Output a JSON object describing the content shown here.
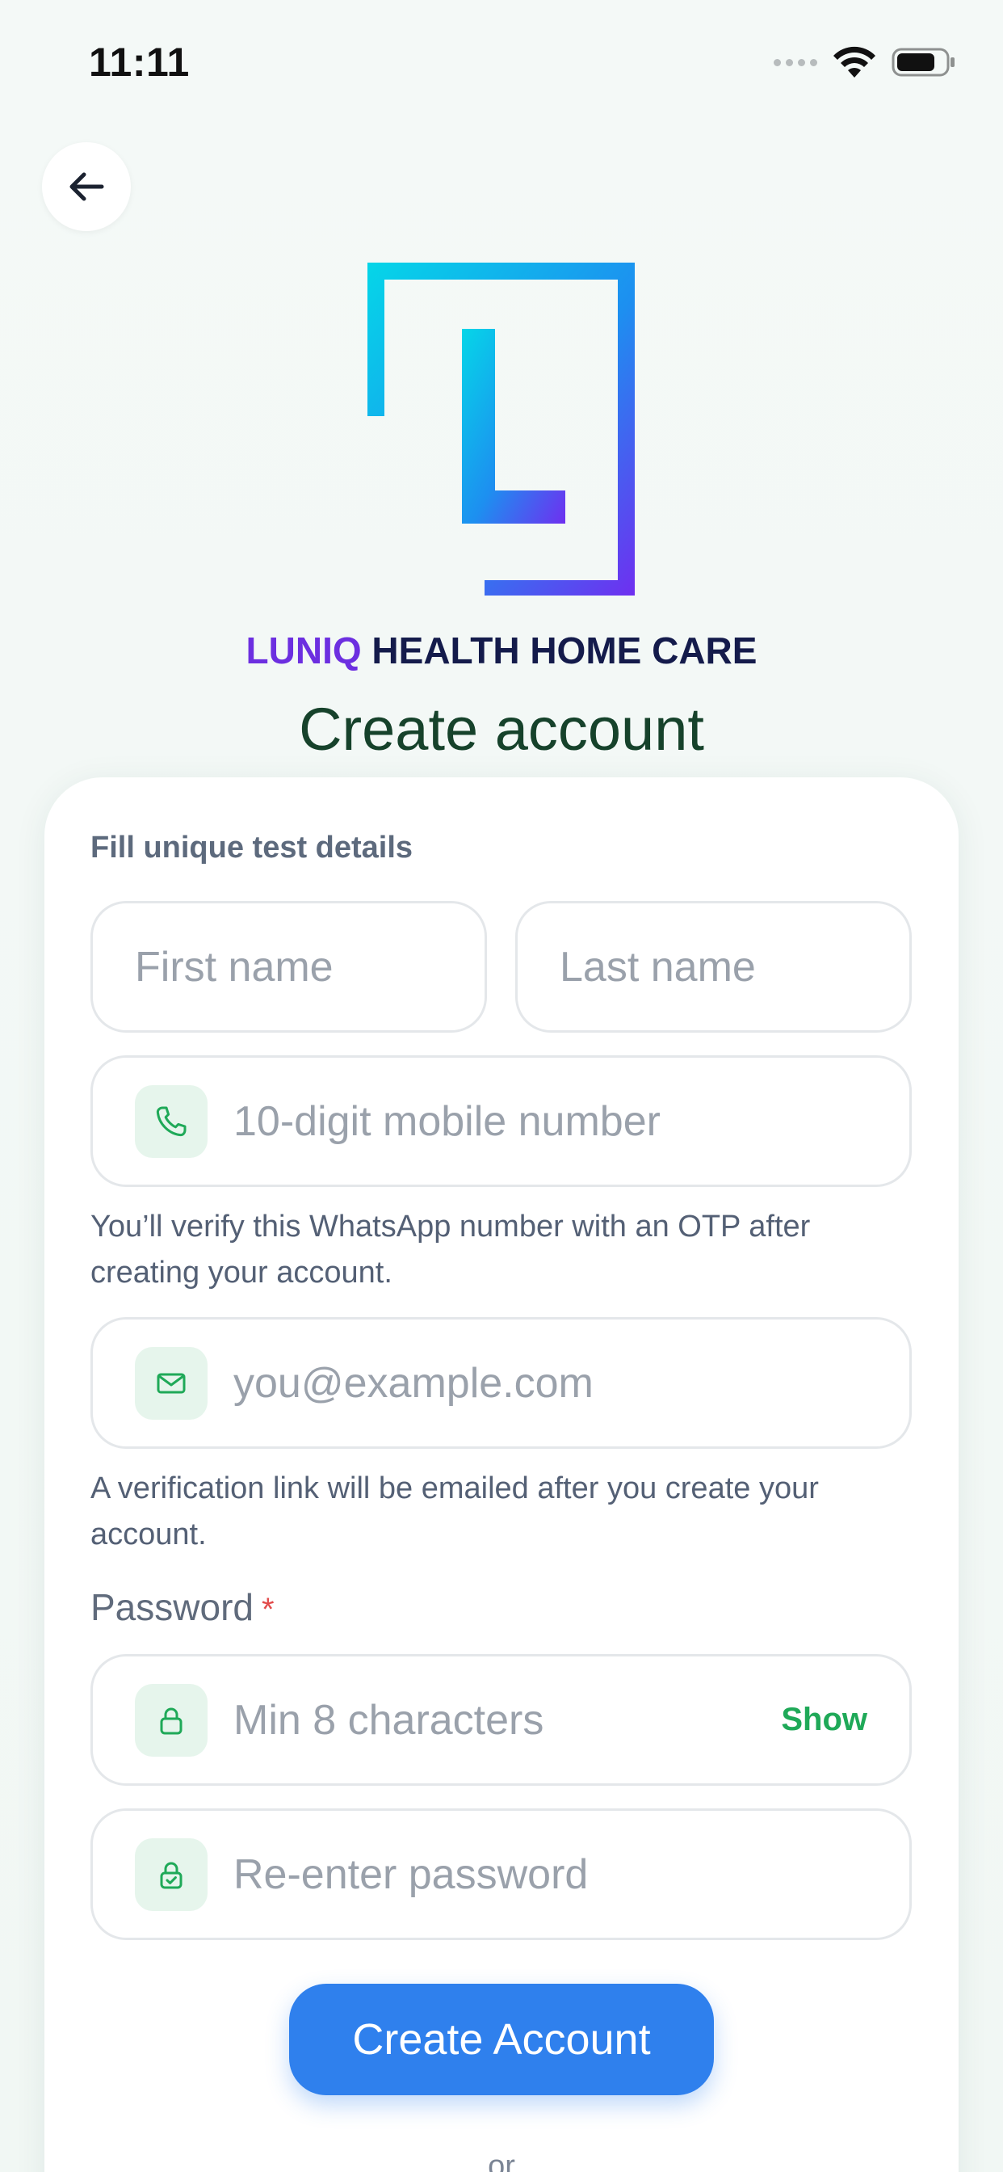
{
  "status_bar": {
    "time": "11:11"
  },
  "header": {
    "back_icon": "arrow-left-icon",
    "brand_part1": "LUNIQ",
    "brand_part2": " HEALTH HOME CARE",
    "title": "Create account"
  },
  "form": {
    "section_label": "Fill unique test details",
    "first_name": {
      "value": "",
      "placeholder": "First name"
    },
    "last_name": {
      "value": "",
      "placeholder": "Last name"
    },
    "phone": {
      "value": "",
      "placeholder": "10-digit mobile number",
      "icon": "phone-icon"
    },
    "phone_hint": "You’ll verify this WhatsApp number with an OTP after creating your account.",
    "email": {
      "value": "",
      "placeholder": "you@example.com",
      "icon": "mail-icon"
    },
    "email_hint": "A verification link will be emailed after you create your account.",
    "password_label": "Password",
    "password_required_mark": "*",
    "password": {
      "value": "",
      "placeholder": "Min 8 characters",
      "icon": "lock-icon",
      "toggle_label": "Show"
    },
    "confirm_password": {
      "value": "",
      "placeholder": "Re-enter password",
      "icon": "lock-check-icon"
    },
    "submit_label": "Create Account",
    "divider_text": "or"
  },
  "colors": {
    "accent": "#2f80ed",
    "title": "#16422b",
    "success_green": "#1fa958",
    "icon_bg": "#e6f5ec",
    "required": "#e24b4b"
  }
}
